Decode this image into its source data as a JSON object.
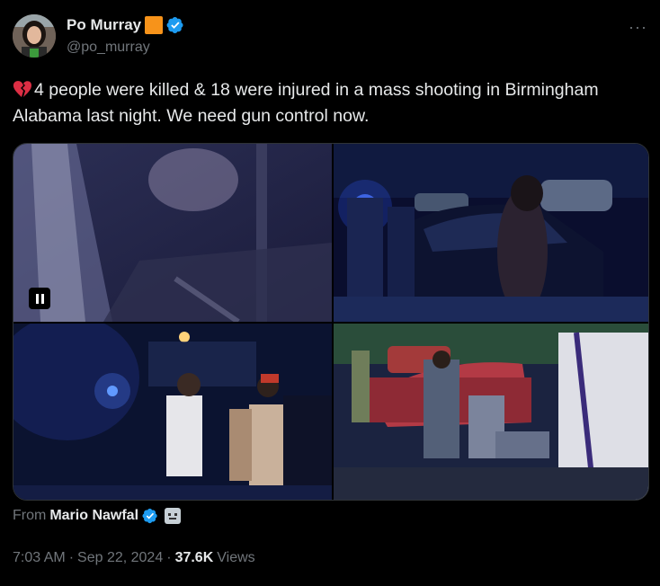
{
  "author": {
    "name": "Po Murray",
    "handle": "@po_murray"
  },
  "menu": {
    "more_label": "···"
  },
  "tweet": {
    "emoji": "broken-heart",
    "text": "4 people were killed & 18 were injured in a mass shooting in Birmingham Alabama last night. We need gun control now."
  },
  "media": {
    "tiles": [
      "video-still-blurry-night-scene",
      "police-lights-crowd-near-car",
      "crowd-standing-at-night",
      "people-attending-injured-near-red-car"
    ],
    "video_state": "paused"
  },
  "source": {
    "from_label": "From",
    "name": "Mario Nawfal"
  },
  "meta": {
    "time": "7:03 AM",
    "sep1": "·",
    "date": "Sep 22, 2024",
    "sep2": "·",
    "views_count": "37.6K",
    "views_label": "Views"
  },
  "colors": {
    "background": "#000000",
    "text": "#e7e9ea",
    "muted": "#71767b",
    "verified": "#1d9bf0",
    "orange_badge": "#f7931a"
  }
}
